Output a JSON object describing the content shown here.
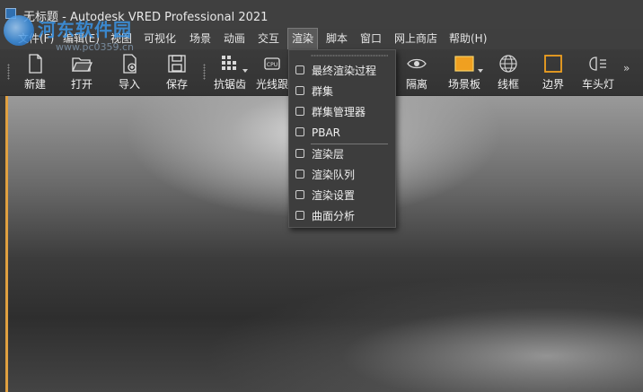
{
  "window": {
    "title": "无标题 - Autodesk VRED Professional 2021"
  },
  "watermark": {
    "text": "河东软件园",
    "url": "www.pc0359.cn"
  },
  "menubar": {
    "items": [
      {
        "label": "文件(F)"
      },
      {
        "label": "编辑(E)"
      },
      {
        "label": "视图"
      },
      {
        "label": "可视化"
      },
      {
        "label": "场景"
      },
      {
        "label": "动画"
      },
      {
        "label": "交互"
      },
      {
        "label": "渲染"
      },
      {
        "label": "脚本"
      },
      {
        "label": "窗口"
      },
      {
        "label": "网上商店"
      },
      {
        "label": "帮助(H)"
      }
    ]
  },
  "toolbar": {
    "items": [
      {
        "label": "新建",
        "icon": "new-file-icon"
      },
      {
        "label": "打开",
        "icon": "folder-open-icon"
      },
      {
        "label": "导入",
        "icon": "import-icon"
      },
      {
        "label": "保存",
        "icon": "save-icon"
      },
      {
        "label": "抗锯齿",
        "icon": "antialiasing-icon"
      },
      {
        "label": "光线跟",
        "icon": "cpu-raytracing-icon"
      },
      {
        "label": "隔离",
        "icon": "isolate-eye-icon"
      },
      {
        "label": "场景板",
        "icon": "sceneplate-icon"
      },
      {
        "label": "线框",
        "icon": "wireframe-icon"
      },
      {
        "label": "边界",
        "icon": "bounding-box-icon"
      },
      {
        "label": "车头灯",
        "icon": "headlight-icon"
      }
    ],
    "overflow": "»"
  },
  "render_menu": {
    "items": [
      {
        "label": "最终渲染过程"
      },
      {
        "label": "群集"
      },
      {
        "label": "群集管理器"
      },
      {
        "label": "PBAR"
      },
      {
        "label": "渲染层"
      },
      {
        "label": "渲染队列"
      },
      {
        "label": "渲染设置"
      },
      {
        "label": "曲面分析"
      }
    ]
  },
  "colors": {
    "accent_orange": "#e0a040",
    "sceneplate_fill": "#f0a020"
  }
}
